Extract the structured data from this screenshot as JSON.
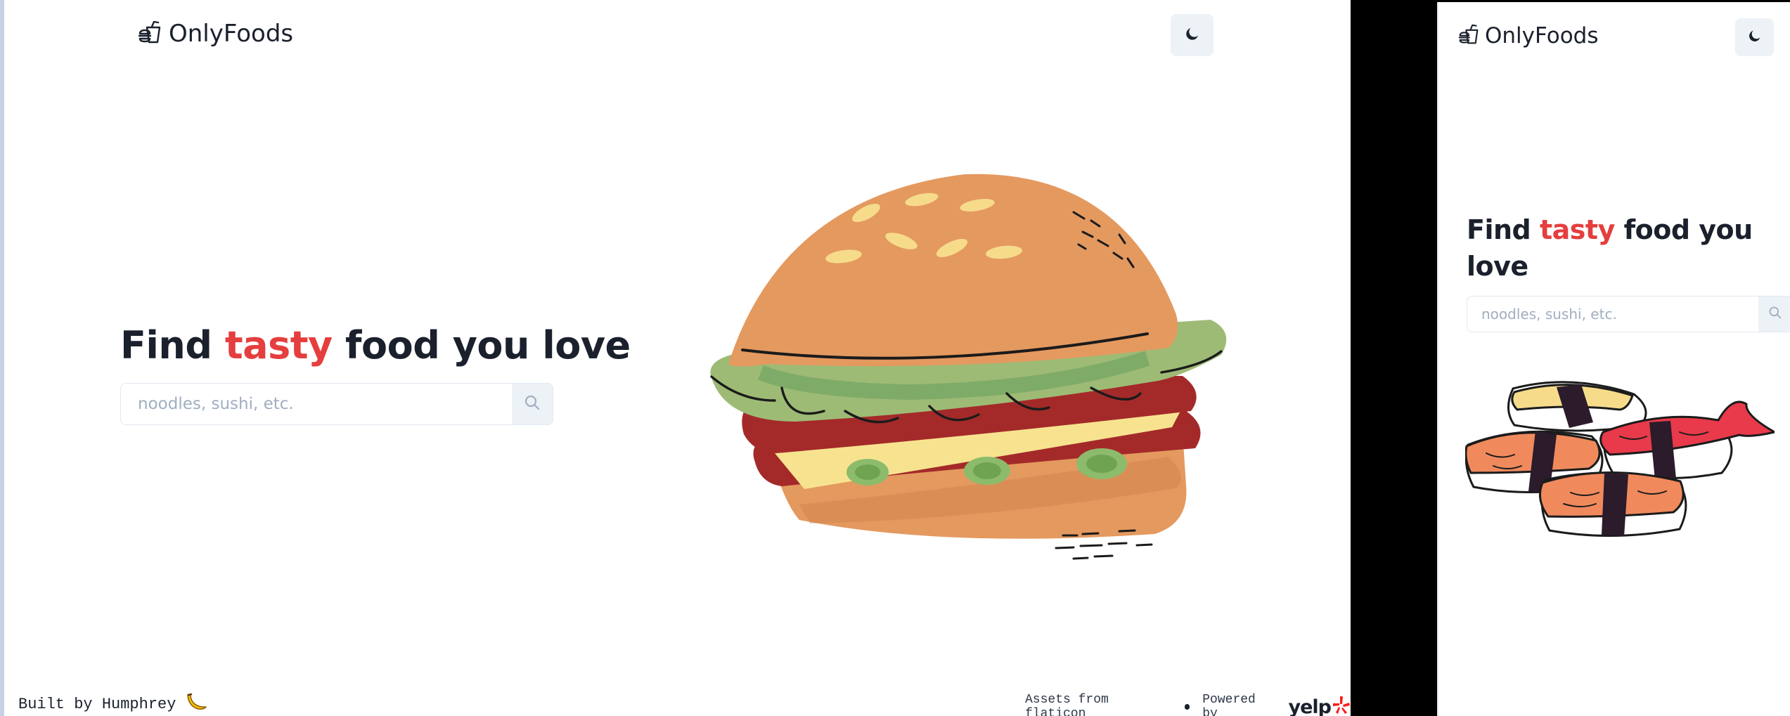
{
  "brand": {
    "name": "OnlyFoods",
    "icon": "food-icon"
  },
  "theme_toggle": {
    "icon": "moon-icon"
  },
  "hero": {
    "title_before": "Find",
    "title_accent": "tasty",
    "title_after": "food you love",
    "search_placeholder": "noodles, sushi, etc.",
    "search_icon": "search-icon"
  },
  "footer": {
    "built_by": "Built by Humphrey",
    "built_by_icon": "banana-icon",
    "assets": "Assets from flaticon",
    "powered_by": "Powered by",
    "provider": "yelp"
  },
  "illustrations": {
    "desktop": "burger-illustration",
    "mobile": "sushi-illustration"
  },
  "colors": {
    "accent": "#e53e3e",
    "text": "#1a202c",
    "toggle_bg": "#edf2f7",
    "yelp_red": "#ff1a1a"
  }
}
